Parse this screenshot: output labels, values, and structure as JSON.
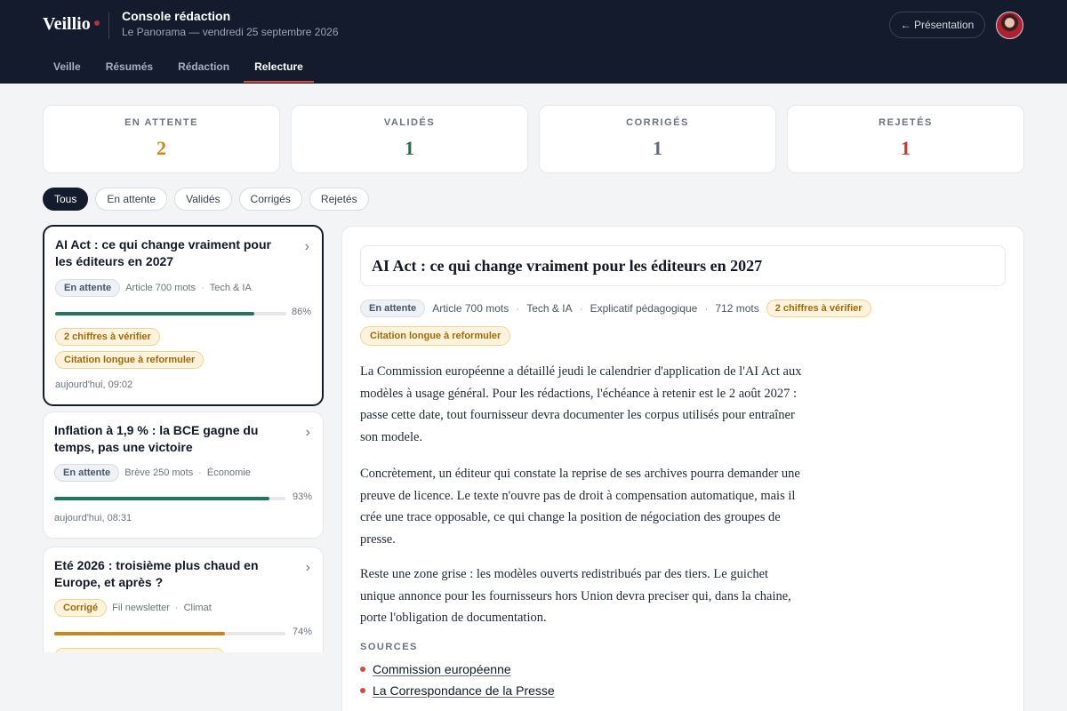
{
  "header": {
    "logo": "Veillio",
    "title": "Console rédaction",
    "subtitle": "Le Panorama — vendredi 25 septembre 2026",
    "presentation_button": "← Présentation"
  },
  "nav": {
    "tabs": [
      {
        "label": "Veille"
      },
      {
        "label": "Résumés"
      },
      {
        "label": "Rédaction"
      },
      {
        "label": "Relecture",
        "active": true
      }
    ]
  },
  "stats": [
    {
      "label": "EN ATTENTE",
      "value": "2",
      "color": "#c9881a"
    },
    {
      "label": "VALIDÉS",
      "value": "1",
      "color": "#2e6b4a"
    },
    {
      "label": "CORRIGÉS",
      "value": "1",
      "color": "#5a6b85"
    },
    {
      "label": "REJETÉS",
      "value": "1",
      "color": "#c8382e"
    }
  ],
  "filters": [
    {
      "label": "Tous",
      "active": true
    },
    {
      "label": "En attente"
    },
    {
      "label": "Validés"
    },
    {
      "label": "Corrigés"
    },
    {
      "label": "Rejetés"
    }
  ],
  "articles": [
    {
      "title": "AI Act : ce qui change vraiment pour les éditeurs en 2027",
      "status": "En attente",
      "format": "Article 700 mots",
      "category": "Tech & IA",
      "progress": 86,
      "progress_label": "86%",
      "progress_color": "#1f7a5c",
      "warnings": [
        "2 chiffres à vérifier",
        "Citation longue à reformuler"
      ],
      "time": "aujourd'hui, 09:02"
    },
    {
      "title": "Inflation à 1,9 % : la BCE gagne du temps, pas une victoire",
      "status": "En attente",
      "format": "Brève 250 mots",
      "category": "Économie",
      "progress": 93,
      "progress_label": "93%",
      "progress_color": "#1f7a5c",
      "warnings": [],
      "time": "aujourd'hui, 08:31"
    },
    {
      "title": "Eté 2026 : troisième plus chaud en Europe, et après ?",
      "status": "Corrigé",
      "format": "Fil newsletter",
      "category": "Climat",
      "progress": 74,
      "progress_label": "74%",
      "progress_color": "#c9881a",
      "warnings": [],
      "time": ""
    }
  ],
  "detail": {
    "title": "AI Act : ce qui change vraiment pour les éditeurs en 2027",
    "status": "En attente",
    "format": "Article 700 mots",
    "category": "Tech & IA",
    "angle": "Explicatif pédagogique",
    "word_count": "712 mots",
    "warnings": [
      "2 chiffres à vérifier",
      "Citation longue à reformuler"
    ],
    "paragraphs": [
      "La Commission européenne a détaillé jeudi le calendrier d'application de l'AI Act aux modèles à usage général. Pour les rédactions, l'échéance à retenir est le 2 août 2027 : passe cette date, tout fournisseur devra documenter les corpus utilisés pour entraîner son modele.",
      "Concrètement, un éditeur qui constate la reprise de ses archives pourra demander une preuve de licence. Le texte n'ouvre pas de droit à compensation automatique, mais il crée une trace opposable, ce qui change la position de négociation des groupes de presse.",
      "Reste une zone grise : les modèles ouverts redistribués par des tiers. Le guichet unique annonce pour les fournisseurs hors Union devra preciser qui, dans la chaine, porte l'obligation de documentation."
    ],
    "sources_label": "SOURCES",
    "sources": [
      "Commission européenne",
      "La Correspondance de la Presse"
    ]
  }
}
